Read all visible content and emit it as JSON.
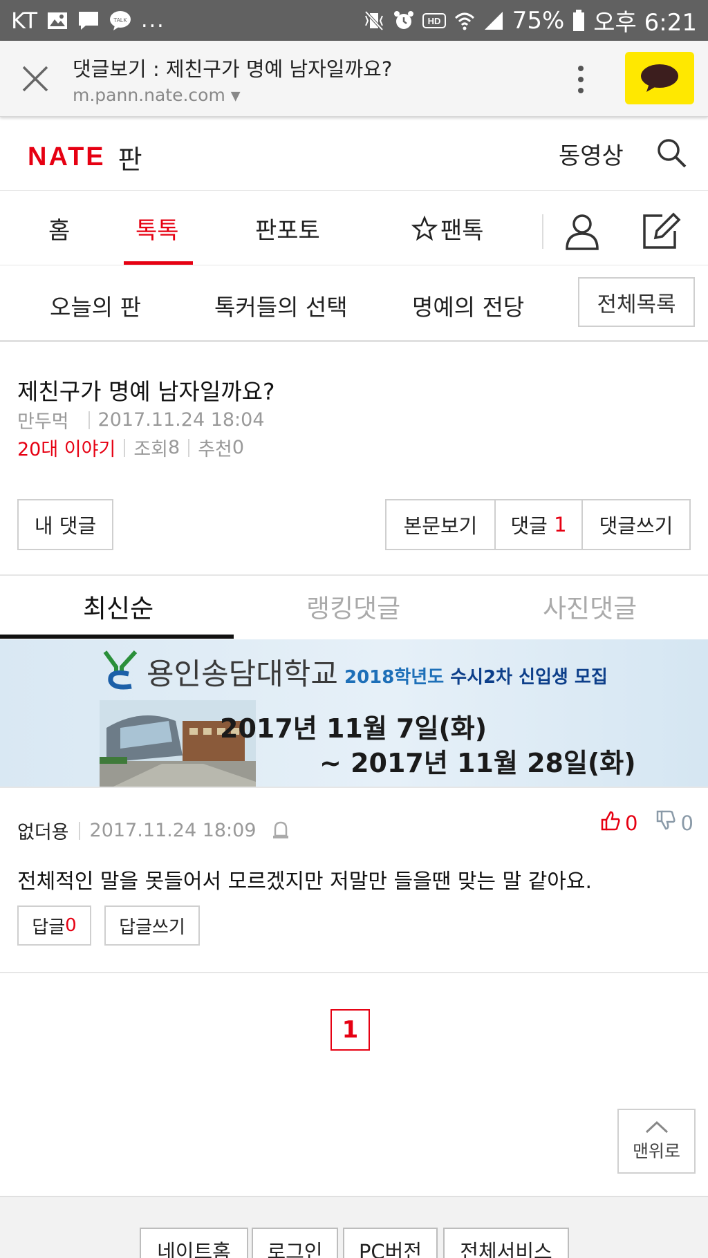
{
  "status_bar": {
    "carrier": "KT",
    "talk_badge": "TALK",
    "more": "...",
    "battery": "75%",
    "time": "오후 6:21"
  },
  "chrome": {
    "page_title": "댓글보기 : 제친구가 명예 남자일까요?",
    "url": "m.pann.nate.com"
  },
  "header": {
    "logo_text": "NATE",
    "logo_sub": "판",
    "video": "동영상"
  },
  "main_nav": {
    "items": [
      {
        "label": "홈"
      },
      {
        "label": "톡톡"
      },
      {
        "label": "판포토"
      },
      {
        "label": "팬톡"
      }
    ]
  },
  "sub_nav": {
    "items": [
      {
        "label": "오늘의 판"
      },
      {
        "label": "톡커들의 선택"
      },
      {
        "label": "명예의 전당"
      }
    ],
    "all_list": "전체목록"
  },
  "post": {
    "title": "제친구가 명예 남자일까요?",
    "author": "만두먹",
    "date": "2017.11.24 18:04",
    "category": "20대 이야기",
    "views_label": "조회",
    "views": "8",
    "recommend_label": "추천",
    "recommend": "0"
  },
  "actions": {
    "my_comments": "내 댓글",
    "view_body": "본문보기",
    "comments_label": "댓글",
    "comments_count": "1",
    "write_comment": "댓글쓰기"
  },
  "sort_tabs": [
    {
      "label": "최신순"
    },
    {
      "label": "랭킹댓글"
    },
    {
      "label": "사진댓글"
    }
  ],
  "banner": {
    "school": "용인송담대학교",
    "recruit_year": "2018학년도",
    "recruit_title": "수시2차 신입생 모집",
    "date_start": "2017년 11월 7일(화)",
    "date_end": "~   2017년 11월 28일(화)"
  },
  "comment": {
    "author": "없더용",
    "date": "2017.11.24 18:09",
    "likes": "0",
    "dislikes": "0",
    "text": "전체적인 말을 못들어서 모르겠지만 저말만 들을땐 맞는 말 같아요.",
    "reply_label": "답글",
    "reply_count": "0",
    "write_reply": "답글쓰기"
  },
  "pagination": {
    "current": "1"
  },
  "to_top": "맨위로",
  "footer": {
    "links": [
      {
        "label": "네이트홈"
      },
      {
        "label": "로그인"
      },
      {
        "label": "PC버전"
      },
      {
        "label": "전체서비스"
      }
    ]
  },
  "colors": {
    "brand_red": "#e60012",
    "kakao_yellow": "#ffe800",
    "status_bar": "#616161"
  }
}
